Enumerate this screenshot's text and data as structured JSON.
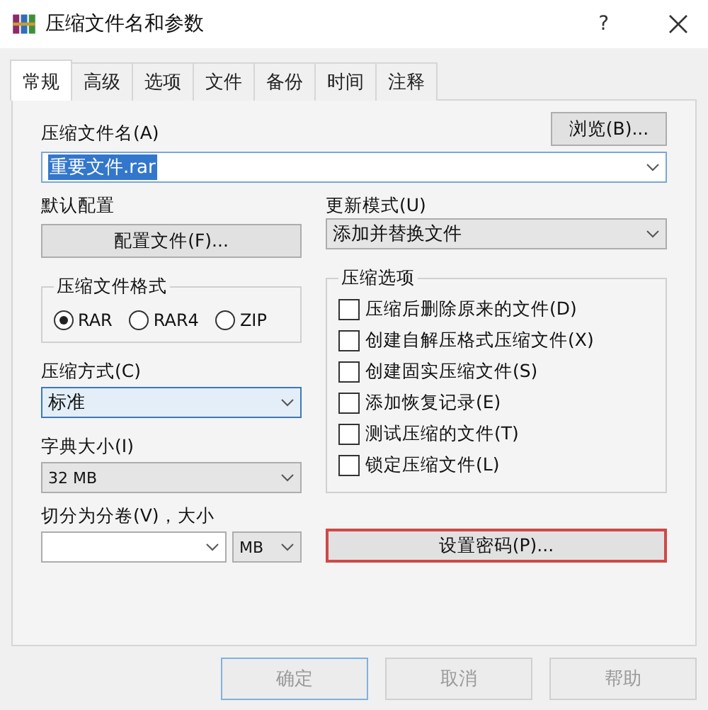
{
  "window": {
    "title": "压缩文件名和参数",
    "help": "?"
  },
  "tabs": [
    {
      "label": "常规",
      "selected": true
    },
    {
      "label": "高级",
      "selected": false
    },
    {
      "label": "选项",
      "selected": false
    },
    {
      "label": "文件",
      "selected": false
    },
    {
      "label": "备份",
      "selected": false
    },
    {
      "label": "时间",
      "selected": false
    },
    {
      "label": "注释",
      "selected": false
    }
  ],
  "archive_name": {
    "label": "压缩文件名(A)",
    "value": "重要文件.rar",
    "browse_button": "浏览(B)..."
  },
  "default_profile": {
    "label": "默认配置",
    "button": "配置文件(F)..."
  },
  "update_mode": {
    "label": "更新模式(U)",
    "value": "添加并替换文件"
  },
  "archive_format": {
    "title": "压缩文件格式",
    "options": [
      {
        "label": "RAR",
        "selected": true
      },
      {
        "label": "RAR4",
        "selected": false
      },
      {
        "label": "ZIP",
        "selected": false
      }
    ]
  },
  "compression_method": {
    "label": "压缩方式(C)",
    "value": "标准"
  },
  "dictionary_size": {
    "label": "字典大小(I)",
    "value": "32 MB"
  },
  "split_volumes": {
    "label": "切分为分卷(V)，大小",
    "unit": "MB"
  },
  "archiving_options": {
    "title": "压缩选项",
    "items": [
      {
        "label": "压缩后删除原来的文件(D)",
        "checked": false
      },
      {
        "label": "创建自解压格式压缩文件(X)",
        "checked": false
      },
      {
        "label": "创建固实压缩文件(S)",
        "checked": false
      },
      {
        "label": "添加恢复记录(E)",
        "checked": false
      },
      {
        "label": "测试压缩的文件(T)",
        "checked": false
      },
      {
        "label": "锁定压缩文件(L)",
        "checked": false
      }
    ]
  },
  "password_button": {
    "label": "设置密码(P)...",
    "highlighted": true
  },
  "buttons": [
    {
      "label": "确定",
      "default": true
    },
    {
      "label": "取消",
      "default": false
    },
    {
      "label": "帮助",
      "default": false
    }
  ]
}
